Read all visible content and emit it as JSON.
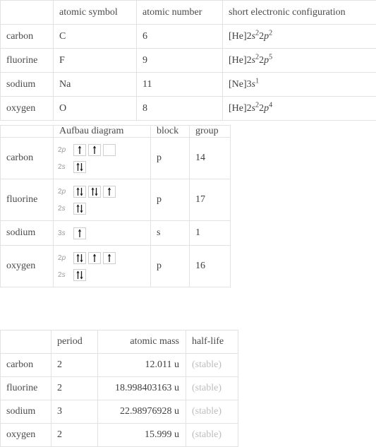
{
  "elements": [
    "carbon",
    "fluorine",
    "sodium",
    "oxygen"
  ],
  "table_properties": {
    "name": "element properties table",
    "corner": "",
    "headers": [
      "",
      "atomic symbol",
      "atomic number",
      "short electronic configuration"
    ],
    "rows": [
      {
        "element": "carbon",
        "atomic_symbol": "C",
        "atomic_number": "6",
        "config_plain": "[He]2s^2 2p^2",
        "config": {
          "core": "[He]2",
          "o1": "s",
          "e1": "2",
          "mid": "2",
          "o2": "p",
          "e2": "2"
        }
      },
      {
        "element": "fluorine",
        "atomic_symbol": "F",
        "atomic_number": "9",
        "config_plain": "[He]2s^2 2p^5",
        "config": {
          "core": "[He]2",
          "o1": "s",
          "e1": "2",
          "mid": "2",
          "o2": "p",
          "e2": "5"
        }
      },
      {
        "element": "sodium",
        "atomic_symbol": "Na",
        "atomic_number": "11",
        "config_plain": "[Ne]3s^1",
        "config": {
          "core": "[Ne]3",
          "o1": "s",
          "e1": "1",
          "mid": "",
          "o2": "",
          "e2": ""
        }
      },
      {
        "element": "oxygen",
        "atomic_symbol": "O",
        "atomic_number": "8",
        "config_plain": "[He]2s^2 2p^4",
        "config": {
          "core": "[He]2",
          "o1": "s",
          "e1": "2",
          "mid": "2",
          "o2": "p",
          "e2": "4"
        }
      }
    ]
  },
  "table_aufbau": {
    "name": "aufbau diagram table",
    "headers": [
      "",
      "Aufbau diagram",
      "block",
      "group"
    ],
    "rows": [
      {
        "element": "carbon",
        "block": "p",
        "group": "14",
        "shells": [
          {
            "label_n": "2",
            "label_l": "p",
            "orbitals": [
              "up",
              "up",
              "empty"
            ]
          },
          {
            "label_n": "2",
            "label_l": "s",
            "orbitals": [
              "pair"
            ]
          }
        ]
      },
      {
        "element": "fluorine",
        "block": "p",
        "group": "17",
        "shells": [
          {
            "label_n": "2",
            "label_l": "p",
            "orbitals": [
              "pair",
              "pair",
              "up"
            ]
          },
          {
            "label_n": "2",
            "label_l": "s",
            "orbitals": [
              "pair"
            ]
          }
        ]
      },
      {
        "element": "sodium",
        "block": "s",
        "group": "1",
        "shells": [
          {
            "label_n": "3",
            "label_l": "s",
            "orbitals": [
              "up"
            ]
          }
        ]
      },
      {
        "element": "oxygen",
        "block": "p",
        "group": "16",
        "shells": [
          {
            "label_n": "2",
            "label_l": "p",
            "orbitals": [
              "pair",
              "up",
              "up"
            ]
          },
          {
            "label_n": "2",
            "label_l": "s",
            "orbitals": [
              "pair"
            ]
          }
        ]
      }
    ]
  },
  "table_mass": {
    "name": "period, atomic mass and half-life table",
    "headers": [
      "",
      "period",
      "atomic mass",
      "half-life"
    ],
    "rows": [
      {
        "element": "carbon",
        "period": "2",
        "atomic_mass": "12.011 u",
        "half_life": "(stable)"
      },
      {
        "element": "fluorine",
        "period": "2",
        "atomic_mass": "18.998403163 u",
        "half_life": "(stable)"
      },
      {
        "element": "sodium",
        "period": "3",
        "atomic_mass": "22.98976928 u",
        "half_life": "(stable)"
      },
      {
        "element": "oxygen",
        "period": "2",
        "atomic_mass": "15.999 u",
        "half_life": "(stable)"
      }
    ]
  },
  "colors": {
    "border": "#e2e2e2",
    "text": "#404040",
    "muted": "#9a9a9a",
    "stable": "#bdbdbd",
    "orbital_border": "#cfcfcf",
    "arrow": "#1a1a1a"
  }
}
